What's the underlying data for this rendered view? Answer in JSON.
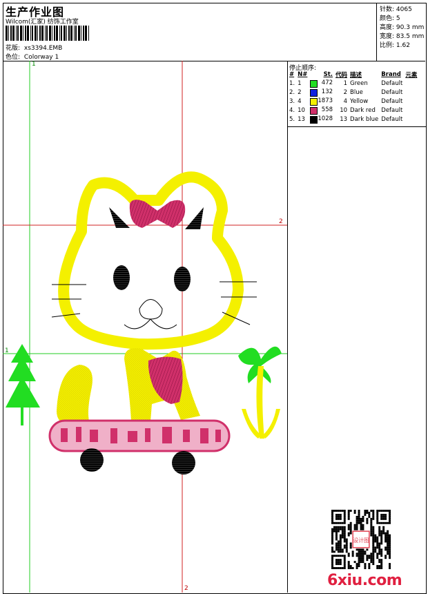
{
  "header": {
    "title": "生产作业图",
    "company": "Wilcom(汇家) 纺饰工作室",
    "design_label": "花版:",
    "design_value": "xs3394.EMB",
    "colorway_label": "色位:",
    "colorway_value": "Colorway 1"
  },
  "stats": [
    {
      "label": "针数:",
      "value": "4065"
    },
    {
      "label": "颜色:",
      "value": "5"
    },
    {
      "label": "高度:",
      "value": "90.3 mm"
    },
    {
      "label": "宽度:",
      "value": "83.5 mm"
    },
    {
      "label": "比例:",
      "value": "1.62"
    }
  ],
  "stop_sequence": {
    "title": "停止顺序:",
    "headers": [
      "#",
      "N#",
      "St.",
      "代码",
      "描述",
      "Brand",
      "元素"
    ],
    "rows": [
      {
        "idx": "1.",
        "n": "1",
        "color": "#22dd22",
        "st": "472",
        "code": "1",
        "desc": "Green",
        "brand": "Default"
      },
      {
        "idx": "2.",
        "n": "2",
        "color": "#1020e0",
        "st": "132",
        "code": "2",
        "desc": "Blue",
        "brand": "Default"
      },
      {
        "idx": "3.",
        "n": "4",
        "color": "#f4f000",
        "st": "1873",
        "code": "4",
        "desc": "Yellow",
        "brand": "Default"
      },
      {
        "idx": "4.",
        "n": "10",
        "color": "#d0306a",
        "st": "558",
        "code": "10",
        "desc": "Dark red",
        "brand": "Default"
      },
      {
        "idx": "5.",
        "n": "13",
        "color": "#000000",
        "st": "1028",
        "code": "13",
        "desc": "Dark blue",
        "brand": "Default"
      }
    ]
  },
  "guides": {
    "v_green": "1",
    "h_green": "1",
    "v_red": "2",
    "h_red": "2"
  },
  "watermark": "6xiu.com",
  "qr_stamp": "设计图"
}
